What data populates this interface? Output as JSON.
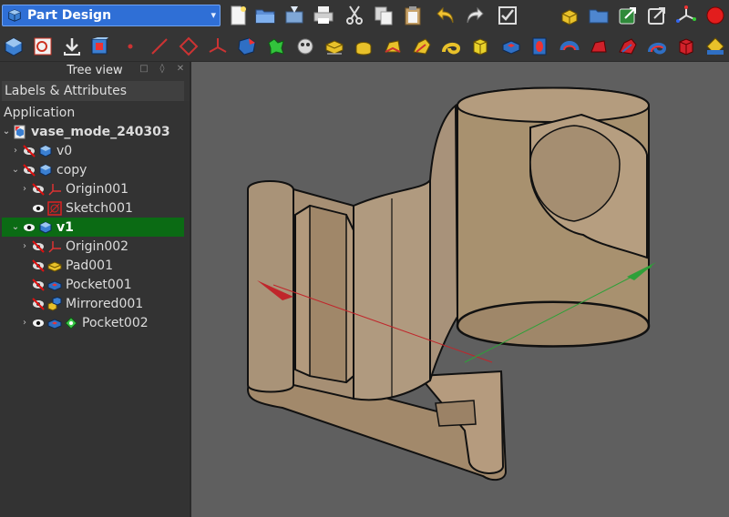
{
  "toolbar": {
    "workbench": "Part Design",
    "top_icons": [
      "new-file-icon",
      "open-folder-icon",
      "save-icon",
      "print-icon",
      "cut-icon",
      "copy-icon",
      "paste-icon",
      "undo-icon",
      "redo-icon",
      "refresh-icon",
      "create-part-icon",
      "create-group-icon",
      "link-icon",
      "link-actions-icon",
      "axis-cross-icon",
      "record-macro-icon"
    ],
    "second_icons": [
      "create-body-icon",
      "create-sketch-icon",
      "validate-sketch-icon",
      "shape-binder-icon",
      "datum-point-icon",
      "datum-line-icon",
      "datum-plane-icon",
      "local-coordinate-icon",
      "sub-shape-binder-icon",
      "clone-icon",
      "sprocket-icon",
      "pad-icon",
      "revolution-icon",
      "additive-loft-icon",
      "additive-pipe-icon",
      "additive-helix-icon",
      "additive-box-icon",
      "pocket-icon",
      "hole-icon",
      "groove-icon",
      "subtractive-loft-icon",
      "subtractive-pipe-icon",
      "subtractive-helix-icon",
      "subtractive-box-icon",
      "measure-icon"
    ]
  },
  "tree_panel": {
    "title": "Tree view",
    "column_header": "Labels & Attributes",
    "section": "Application",
    "items": [
      {
        "label": "vase_mode_240303",
        "bold": true
      },
      {
        "label": "v0"
      },
      {
        "label": "copy"
      },
      {
        "label": "Origin001"
      },
      {
        "label": "Sketch001"
      },
      {
        "label": "v1",
        "selected": true
      },
      {
        "label": "Origin002"
      },
      {
        "label": "Pad001"
      },
      {
        "label": "Pocket001"
      },
      {
        "label": "Mirrored001"
      },
      {
        "label": "Pocket002"
      }
    ]
  },
  "colors": {
    "selection": "#0b6b14",
    "model_face": "#a99378",
    "viewport_bg": "#5f5f5f",
    "workbench_select": "#2f6fd6"
  }
}
